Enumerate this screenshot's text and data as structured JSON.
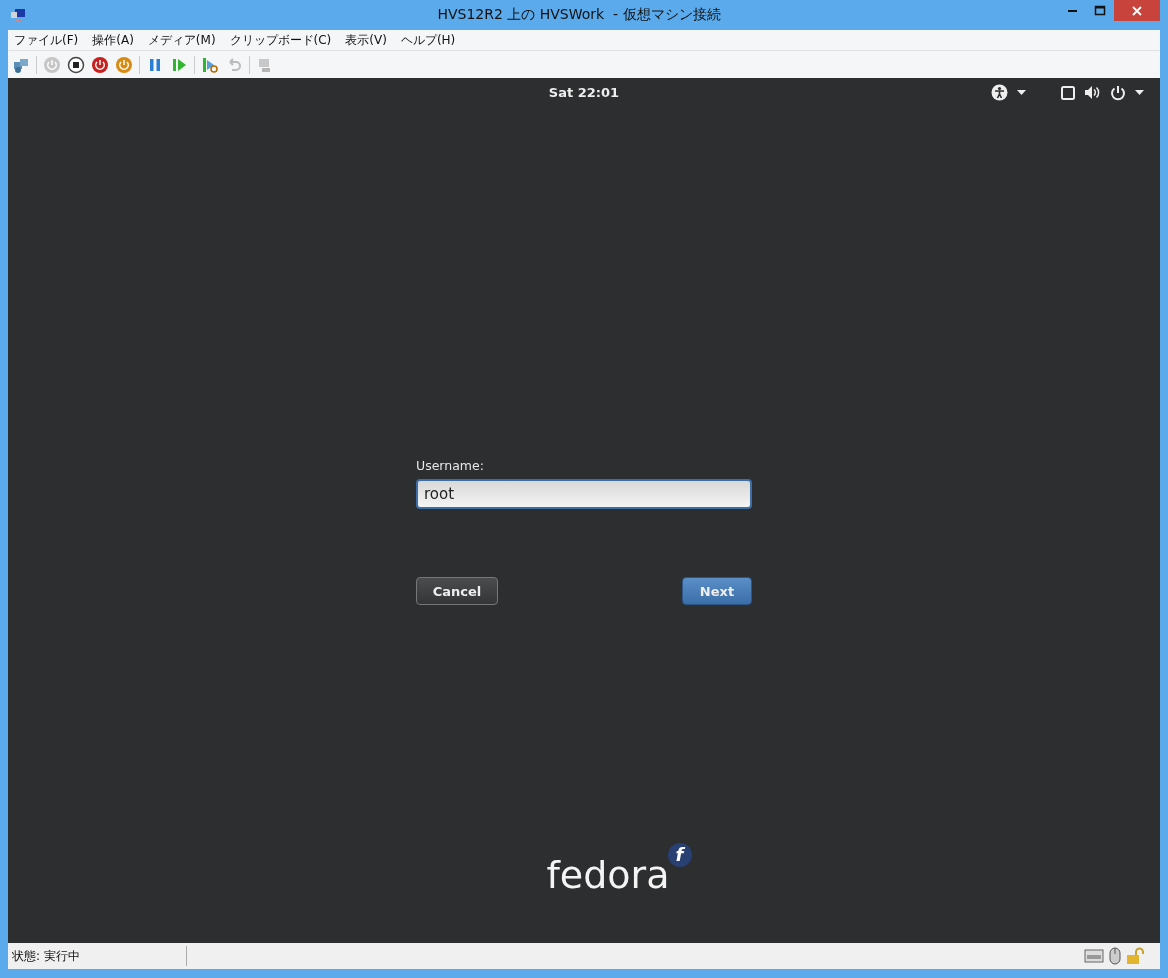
{
  "window": {
    "title": "HVS12R2 上の HVSWork  - 仮想マシン接続"
  },
  "menu": [
    "ファイル(F)",
    "操作(A)",
    "メディア(M)",
    "クリップボード(C)",
    "表示(V)",
    "ヘルプ(H)"
  ],
  "vm_screen": {
    "clock": "Sat 22:01",
    "login": {
      "label": "Username:",
      "value": "root",
      "buttons": [
        {
          "label": "Cancel",
          "kind": "secondary"
        },
        {
          "label": "Next",
          "kind": "primary"
        }
      ]
    },
    "logo": {
      "text": "fedora",
      "mark": "f"
    }
  },
  "status_bar": {
    "text": "状態: 実行中"
  }
}
